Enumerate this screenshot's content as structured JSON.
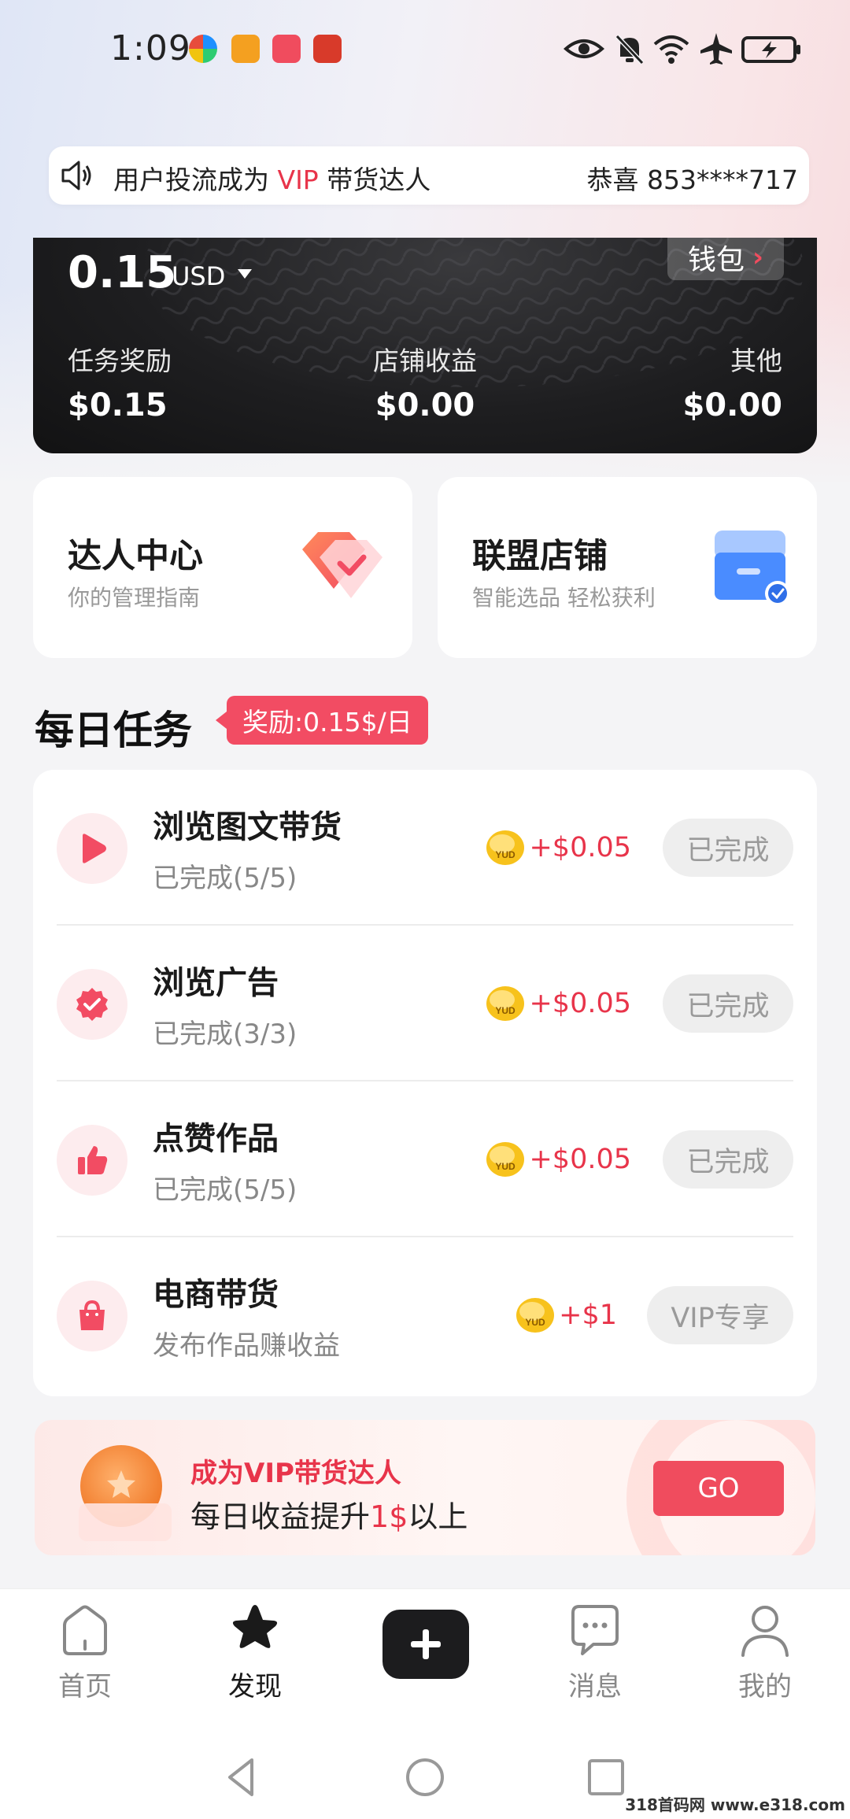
{
  "status_bar": {
    "time": "1:09"
  },
  "notice": {
    "text_prefix": "用户投流成为 ",
    "text_highlight": "VIP",
    "text_suffix": " 带货达人",
    "text_right": "恭喜 853****717"
  },
  "wallet": {
    "balance": "0.15",
    "currency": "USD",
    "wallet_button": "钱包",
    "stats": [
      {
        "label": "任务奖励",
        "value": "$0.15"
      },
      {
        "label": "店铺收益",
        "value": "$0.00"
      },
      {
        "label": "其他",
        "value": "$0.00"
      }
    ]
  },
  "center_cards": [
    {
      "title": "达人中心",
      "subtitle": "你的管理指南"
    },
    {
      "title": "联盟店铺",
      "subtitle": "智能选品 轻松获利"
    }
  ],
  "daily_tasks": {
    "title": "每日任务",
    "badge": "奖励:0.15$/日",
    "coin_label": "YUD",
    "items": [
      {
        "name": "浏览图文带货",
        "status": "已完成(5/5)",
        "reward": "+$0.05",
        "button": "已完成",
        "icon": "play-icon"
      },
      {
        "name": "浏览广告",
        "status": "已完成(3/3)",
        "reward": "+$0.05",
        "button": "已完成",
        "icon": "verified-badge-icon"
      },
      {
        "name": "点赞作品",
        "status": "已完成(5/5)",
        "reward": "+$0.05",
        "button": "已完成",
        "icon": "thumbs-up-icon"
      },
      {
        "name": "电商带货",
        "status": "发布作品赚收益",
        "reward": "+$1",
        "button": "VIP专享",
        "icon": "shopping-bag-icon"
      }
    ]
  },
  "vip_banner": {
    "title": "成为VIP带货达人",
    "line_prefix": "每日收益提升",
    "line_highlight": "1$",
    "line_suffix": "以上",
    "button": "GO"
  },
  "tab_bar": {
    "tabs": [
      {
        "label": "首页",
        "icon": "home-icon"
      },
      {
        "label": "发现",
        "icon": "star-icon"
      },
      {
        "label": "消息",
        "icon": "message-icon"
      },
      {
        "label": "我的",
        "icon": "profile-icon"
      }
    ]
  },
  "watermark": "318首码网 www.e318.com",
  "colors": {
    "accent": "#e8344a",
    "badge": "#f24c63",
    "wallet_bg": "#1e1e20",
    "go_button": "#f04c5e"
  }
}
